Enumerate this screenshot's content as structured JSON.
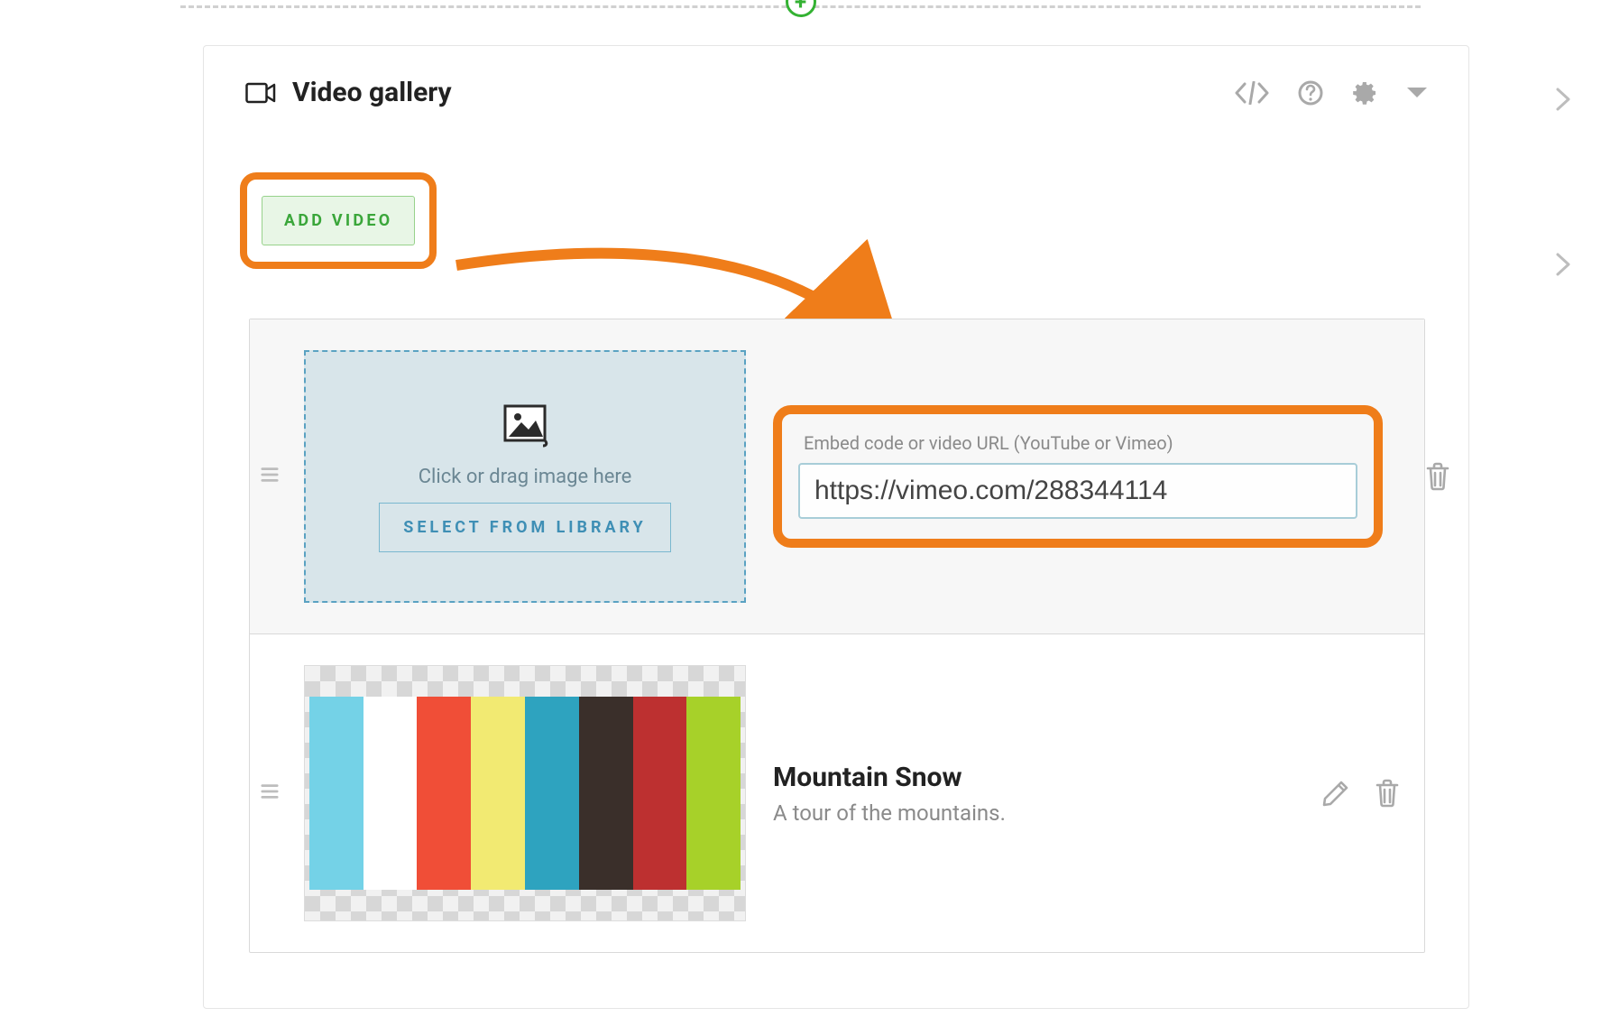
{
  "header": {
    "title": "Video gallery"
  },
  "add_video_label": "ADD VIDEO",
  "dropzone": {
    "hint": "Click or drag image here",
    "select_label": "SELECT FROM LIBRARY"
  },
  "url_field": {
    "label": "Embed code or video URL (YouTube or Vimeo)",
    "value": "https://vimeo.com/288344114"
  },
  "videos": [
    {
      "title": "Mountain Snow",
      "subtitle": "A tour of the mountains."
    }
  ],
  "colors": {
    "orange": "#ef7d1a",
    "green": "#34b233",
    "bars": [
      "#74d2e7",
      "#ffffff",
      "#f04e37",
      "#f2ea72",
      "#2ea3bf",
      "#3a2f2a",
      "#bd3030",
      "#a7d129"
    ]
  }
}
